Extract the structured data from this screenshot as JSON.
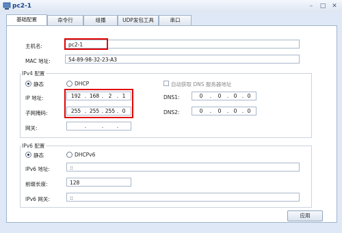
{
  "window": {
    "title": "pc2-1"
  },
  "tabs": [
    "基础配置",
    "命令行",
    "组播",
    "UDP发包工具",
    "串口"
  ],
  "basic": {
    "hostname_label": "主机名:",
    "hostname_value": "pc2-1",
    "mac_label": "MAC 地址:",
    "mac_value": "54-89-98-32-23-A3"
  },
  "ipv4": {
    "group_title": "IPv4 配置",
    "static_label": "静态",
    "dhcp_label": "DHCP",
    "auto_dns_label": "自动获取 DNS 服务器地址",
    "ip_label": "IP 地址:",
    "ip": [
      "192",
      "168",
      "2",
      "1"
    ],
    "mask_label": "子网掩码:",
    "mask": [
      "255",
      "255",
      "255",
      "0"
    ],
    "gateway_label": "网关:",
    "gateway": [
      "",
      "",
      "",
      ""
    ],
    "dns1_label": "DNS1:",
    "dns1": [
      "0",
      "0",
      "0",
      "0"
    ],
    "dns2_label": "DNS2:",
    "dns2": [
      "0",
      "0",
      "0",
      "0"
    ]
  },
  "ipv6": {
    "group_title": "IPv6 配置",
    "static_label": "静态",
    "dhcp_label": "DHCPv6",
    "addr_label": "IPv6 地址:",
    "addr_value": "::",
    "prefix_label": "前缀长度:",
    "prefix_value": "128",
    "gateway_label": "IPv6 网关:",
    "gateway_value": "::"
  },
  "apply_label": "应用"
}
